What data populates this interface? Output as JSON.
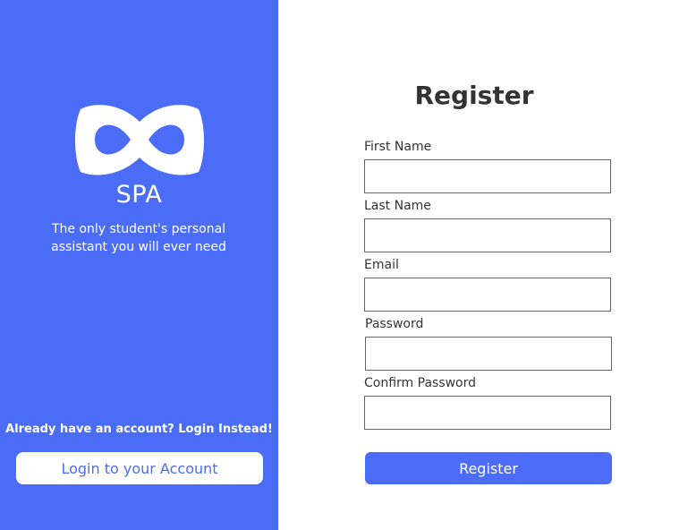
{
  "brand": {
    "name": "SPA",
    "tagline": "The only student's personal assistant you will ever need",
    "logo_icon": "infinity-mask-icon"
  },
  "login": {
    "prompt": "Already have an account? Login Instead!",
    "button_label": "Login to your Account"
  },
  "form": {
    "title": "Register",
    "fields": [
      {
        "label": "First Name",
        "value": ""
      },
      {
        "label": "Last Name",
        "value": ""
      },
      {
        "label": "Email",
        "value": ""
      },
      {
        "label": "Password",
        "value": ""
      },
      {
        "label": "Confirm Password",
        "value": ""
      }
    ],
    "submit_label": "Register"
  },
  "colors": {
    "accent": "#4a6cf7",
    "text": "#333333",
    "background": "#ffffff"
  }
}
